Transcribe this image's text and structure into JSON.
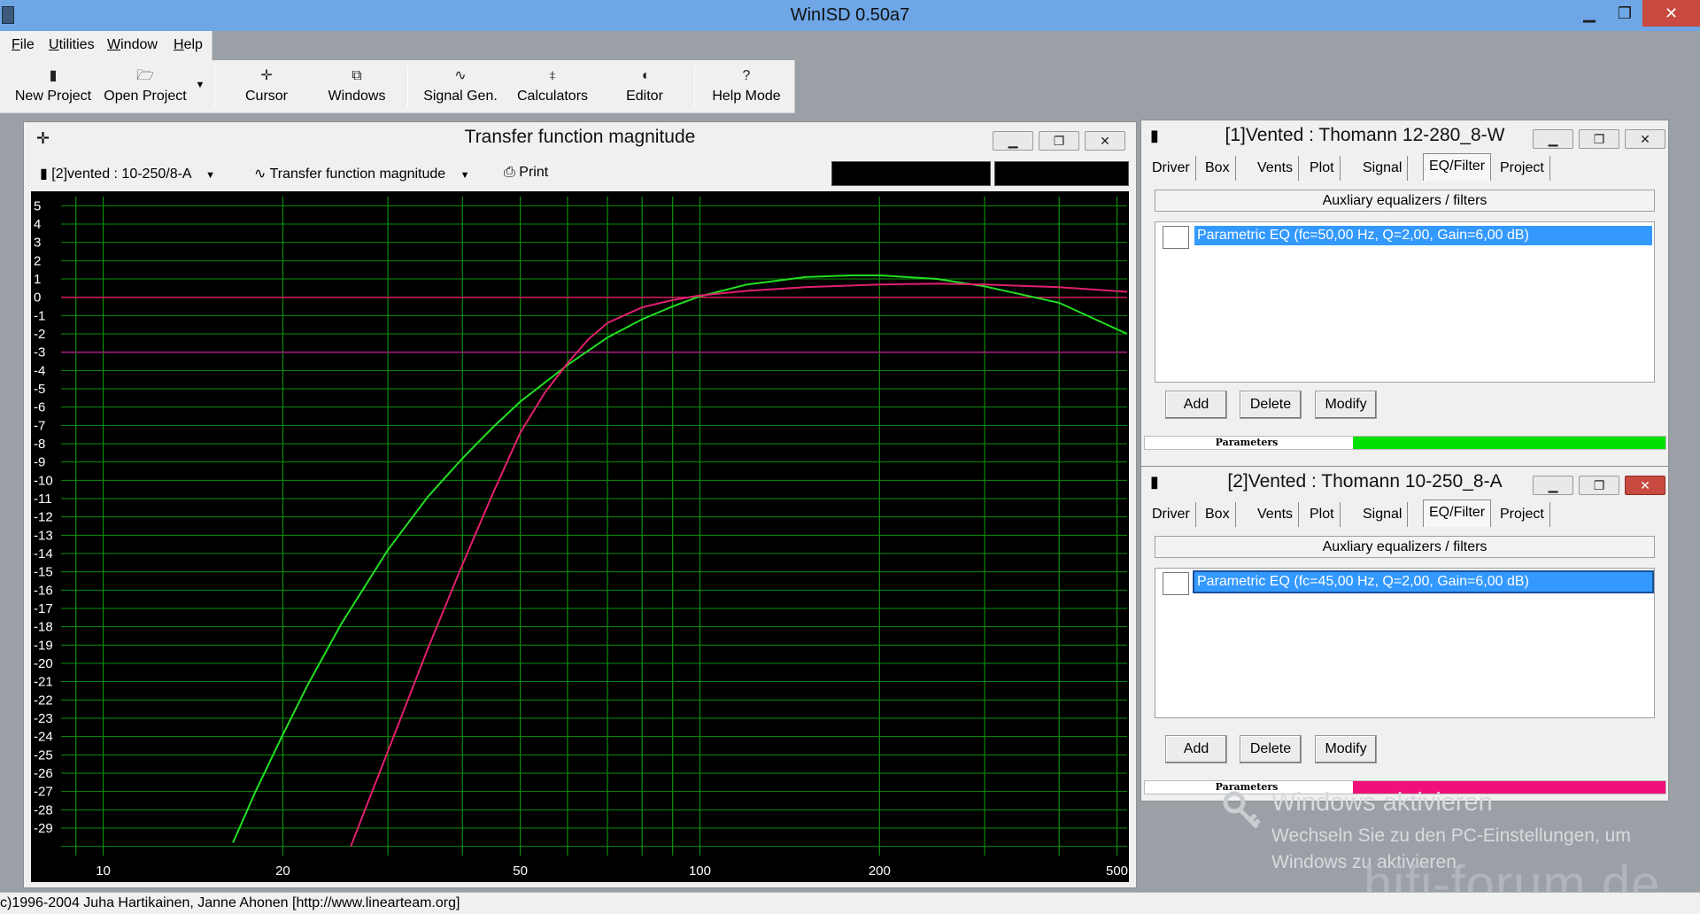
{
  "window": {
    "title": "WinISD 0.50a7",
    "min_glyph": "▁",
    "max_glyph": "❐",
    "close_glyph": "✕"
  },
  "menu": [
    {
      "label_u": "F",
      "label_rest": "ile"
    },
    {
      "label_u": "U",
      "label_rest": "tilities"
    },
    {
      "label_u": "W",
      "label_rest": "indow"
    },
    {
      "label_u": "H",
      "label_rest": "elp"
    }
  ],
  "toolbar": {
    "new_project": "New Project",
    "open_project": "Open Project",
    "cursor": "Cursor",
    "windows": "Windows",
    "signal_gen": "Signal Gen.",
    "calculators": "Calculators",
    "editor": "Editor",
    "help_mode": "Help Mode",
    "icons": {
      "new": "▮",
      "open": "🗁",
      "cursor": "✛",
      "windows": "⧉",
      "signal": "∿",
      "calc": "⧧",
      "editor": "◖",
      "help": "?",
      "dropdown": "▼"
    }
  },
  "graph_window": {
    "title": "Transfer function magnitude",
    "project_select": "[2]vented : 10-250/8-A",
    "graph_select": "Transfer function magnitude",
    "print_label": "Print",
    "icons": {
      "move": "✛",
      "project": "▮",
      "graph": "∿",
      "print": "⎙",
      "dropdown": "▼"
    }
  },
  "chart_data": {
    "type": "line",
    "title": "",
    "xlabel": "",
    "ylabel": "",
    "x_scale": "log",
    "xlim": [
      8.5,
      520
    ],
    "ylim": [
      -30.5,
      5.5
    ],
    "x_tick_labels": [
      10,
      20,
      50,
      100,
      200,
      500
    ],
    "y_tick_labels": [
      5,
      4,
      3,
      2,
      1,
      0,
      -1,
      -2,
      -3,
      -4,
      -5,
      -6,
      -7,
      -8,
      -9,
      -10,
      -11,
      -12,
      -13,
      -14,
      -15,
      -16,
      -17,
      -18,
      -19,
      -20,
      -21,
      -22,
      -23,
      -24,
      -25,
      -26,
      -27,
      -28,
      -29
    ],
    "grid": true,
    "colors": {
      "background": "#000000",
      "grid": "#0b8f0b",
      "axis_text": "#ffffff"
    },
    "reference_lines": [
      {
        "y": 0,
        "color": "#c81e5a"
      },
      {
        "y": -3,
        "color": "#a0207d"
      }
    ],
    "series": [
      {
        "color": "#22e022",
        "x": [
          16.5,
          18,
          20,
          22,
          25,
          30,
          35,
          40,
          45,
          50,
          60,
          70,
          80,
          90,
          100,
          120,
          150,
          180,
          200,
          250,
          300,
          400,
          520
        ],
        "y": [
          -29.8,
          -27,
          -23.9,
          -21.2,
          -17.9,
          -13.8,
          -10.9,
          -8.8,
          -7.1,
          -5.7,
          -3.7,
          -2.2,
          -1.2,
          -0.5,
          0.05,
          0.7,
          1.1,
          1.2,
          1.2,
          1.0,
          0.6,
          -0.3,
          -2.0
        ]
      },
      {
        "color": "#e0206e",
        "x": [
          26,
          28,
          30,
          35,
          40,
          45,
          50,
          55,
          60,
          65,
          70,
          80,
          90,
          100,
          120,
          150,
          200,
          250,
          300,
          400,
          520
        ],
        "y": [
          -30,
          -27.3,
          -24.8,
          -19.2,
          -14.6,
          -10.7,
          -7.4,
          -5.2,
          -3.6,
          -2.3,
          -1.4,
          -0.55,
          -0.15,
          0.1,
          0.35,
          0.55,
          0.7,
          0.75,
          0.7,
          0.55,
          0.3
        ]
      }
    ]
  },
  "driver1": {
    "title": "[1]Vented : Thomann 12-280_8-W",
    "tabs": [
      "Driver",
      "Box",
      "Vents",
      "Plot",
      "Signal",
      "EQ/Filter",
      "Project"
    ],
    "active_tab": "EQ/Filter",
    "aux_title": "Auxliary equalizers / filters",
    "eq_item": "Parametric EQ (fc=50,00 Hz, Q=2,00, Gain=6,00 dB)",
    "add": "Add",
    "delete": "Delete",
    "modify": "Modify",
    "parameters_label": "Parameters",
    "parameters_color": "#00e000"
  },
  "driver2": {
    "title": "[2]Vented : Thomann 10-250_8-A",
    "tabs": [
      "Driver",
      "Box",
      "Vents",
      "Plot",
      "Signal",
      "EQ/Filter",
      "Project"
    ],
    "active_tab": "EQ/Filter",
    "aux_title": "Auxliary equalizers / filters",
    "eq_item": "Parametric EQ (fc=45,00 Hz, Q=2,00, Gain=6,00 dB)",
    "add": "Add",
    "delete": "Delete",
    "modify": "Modify",
    "parameters_label": "Parameters",
    "parameters_color": "#f0107a"
  },
  "watermark": {
    "title": "Windows aktivieren",
    "line1": "Wechseln Sie zu den PC-Einstellungen, um",
    "line2": "Windows zu aktivieren.",
    "site": "hifi-forum.de"
  },
  "status": "c)1996-2004 Juha Hartikainen, Janne Ahonen [http://www.linearteam.org]"
}
